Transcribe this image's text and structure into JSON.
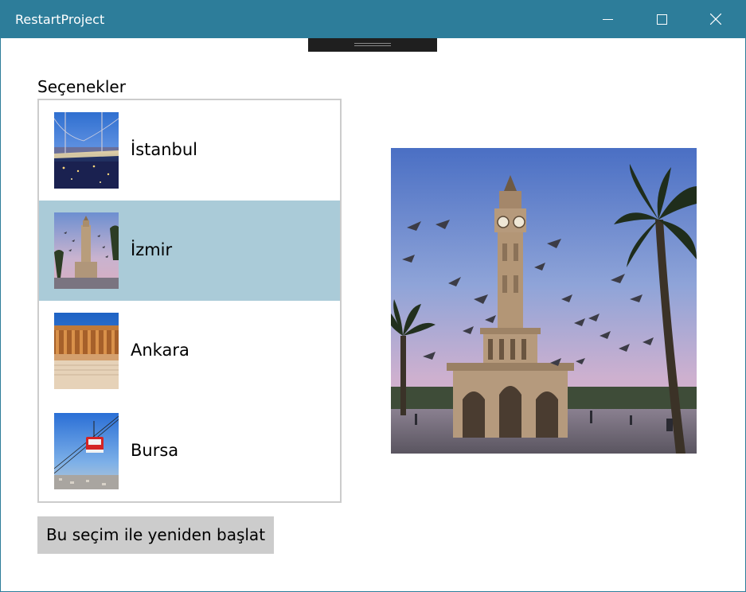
{
  "window": {
    "title": "RestartProject",
    "titlebar_color": "#2d7d9a",
    "controls": [
      "minimize-icon",
      "maximize-icon",
      "close-icon"
    ]
  },
  "options": {
    "label": "Seçenekler",
    "selected_index": 1,
    "selected_color": "#aacbd8",
    "items": [
      {
        "label": "İstanbul",
        "thumbnail": "bosphorus-bridge-night"
      },
      {
        "label": "İzmir",
        "thumbnail": "clock-tower-pigeons"
      },
      {
        "label": "Ankara",
        "thumbnail": "anitkabir-mausoleum"
      },
      {
        "label": "Bursa",
        "thumbnail": "cable-car"
      }
    ]
  },
  "restart_button": {
    "label": "Bu seçim ile yeniden başlat"
  },
  "preview": {
    "image": "izmir-clock-tower-with-pigeons"
  }
}
